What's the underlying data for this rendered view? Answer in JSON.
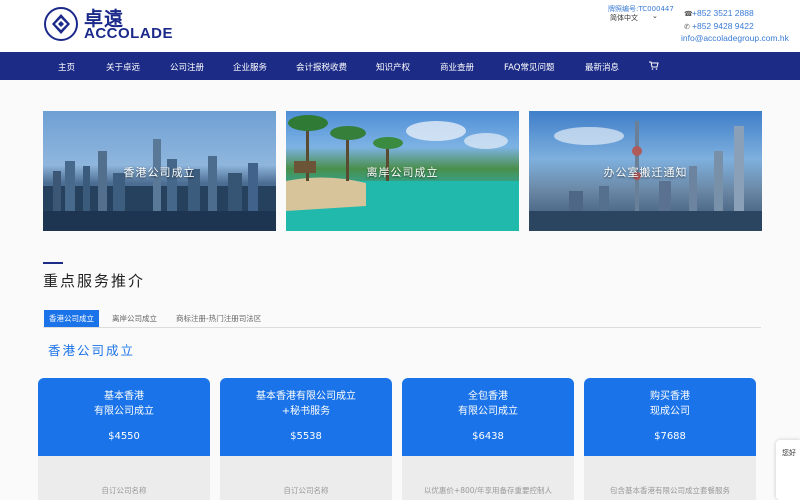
{
  "header": {
    "logo_cn": "卓遠",
    "logo_en": "ACCOLADE",
    "license": "牌照编号:TC000447",
    "language": "简体中文",
    "phone1": "+852 3521 2888",
    "phone2": "+852 9428 9422",
    "email": "info@accoladegroup.com.hk"
  },
  "nav": {
    "items": [
      "主页",
      "关于卓远",
      "公司注册",
      "企业服务",
      "会计报税收费",
      "知识产权",
      "商业查册",
      "FAQ常见问题",
      "最新消息"
    ]
  },
  "banners": [
    "香港公司成立",
    "离岸公司成立",
    "办公室搬迁通知"
  ],
  "section": {
    "title": "重点服务推介",
    "tabs": [
      "香港公司成立",
      "离岸公司成立",
      "商标注册-热门注册司法区"
    ],
    "sub_title": "香港公司成立"
  },
  "cards": [
    {
      "title": "基本香港\n有限公司成立",
      "price": "$4550",
      "desc": "自订公司名称"
    },
    {
      "title": "基本香港有限公司成立\n+秘书服务",
      "price": "$5538",
      "desc": "自订公司名称"
    },
    {
      "title": "全包香港\n有限公司成立",
      "price": "$6438",
      "desc": "以优惠价+800/年享用备存重要控制人"
    },
    {
      "title": "购买香港\n现成公司",
      "price": "$7688",
      "desc": "包含基本香港有限公司成立套餐服务"
    }
  ],
  "chat": {
    "label": "您好"
  }
}
